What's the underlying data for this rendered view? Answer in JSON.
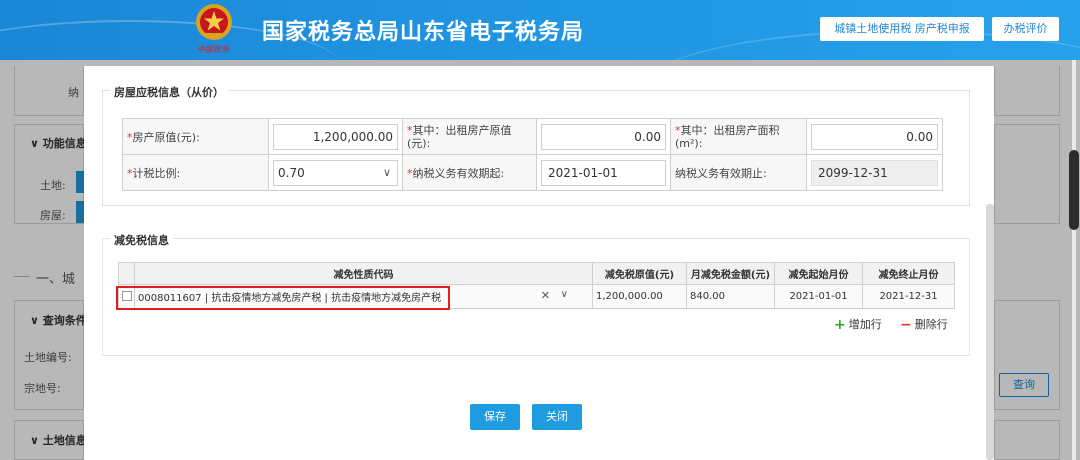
{
  "header": {
    "site_title": "国家税务总局山东省电子税务局",
    "emblem_text": "中国税务",
    "buttons": [
      "城镇土地使用税 房产税申报",
      "办税评价"
    ]
  },
  "background": {
    "left_fragments": [
      "纳",
      "功能信息",
      "土地:",
      "房屋:",
      "一、城",
      "查询条件",
      "土地编号:",
      "宗地号:",
      "土地信息"
    ],
    "query_button": "查询"
  },
  "house_info": {
    "section_title": "房屋应税信息（从价）",
    "fields": {
      "original_value_label": "房产原值(元):",
      "original_value": "1,200,000.00",
      "rent_original_label": "其中：出租房产原值(元):",
      "rent_original_value": "0.00",
      "rent_area_label": "其中：出租房产面积(m²):",
      "rent_area_value": "0.00",
      "tax_ratio_label": "计税比例:",
      "tax_ratio_value": "0.70",
      "duty_start_label": "纳税义务有效期起:",
      "duty_start_value": "2021-01-01",
      "duty_end_label": "纳税义务有效期止:",
      "duty_end_value": "2099-12-31"
    }
  },
  "relief": {
    "section_title": "减免税信息",
    "columns": [
      "减免性质代码",
      "减免税原值(元)",
      "月减免税金额(元)",
      "减免起始月份",
      "减免终止月份"
    ],
    "rows": [
      {
        "code": "0008011607 | 抗击疫情地方减免房产税 | 抗击疫情地方减免房产税",
        "original_value": "1,200,000.00",
        "monthly_amount": "840.00",
        "start_month": "2021-01-01",
        "end_month": "2021-12-31"
      }
    ],
    "add_row": "增加行",
    "delete_row": "删除行"
  },
  "footer": {
    "save": "保存",
    "close": "关闭"
  },
  "colors": {
    "header_blue": "#1f93e0",
    "button_blue": "#1f9be0",
    "highlight_red": "#e02020",
    "add_green": "#2aa52a",
    "delete_red": "#e23030"
  }
}
